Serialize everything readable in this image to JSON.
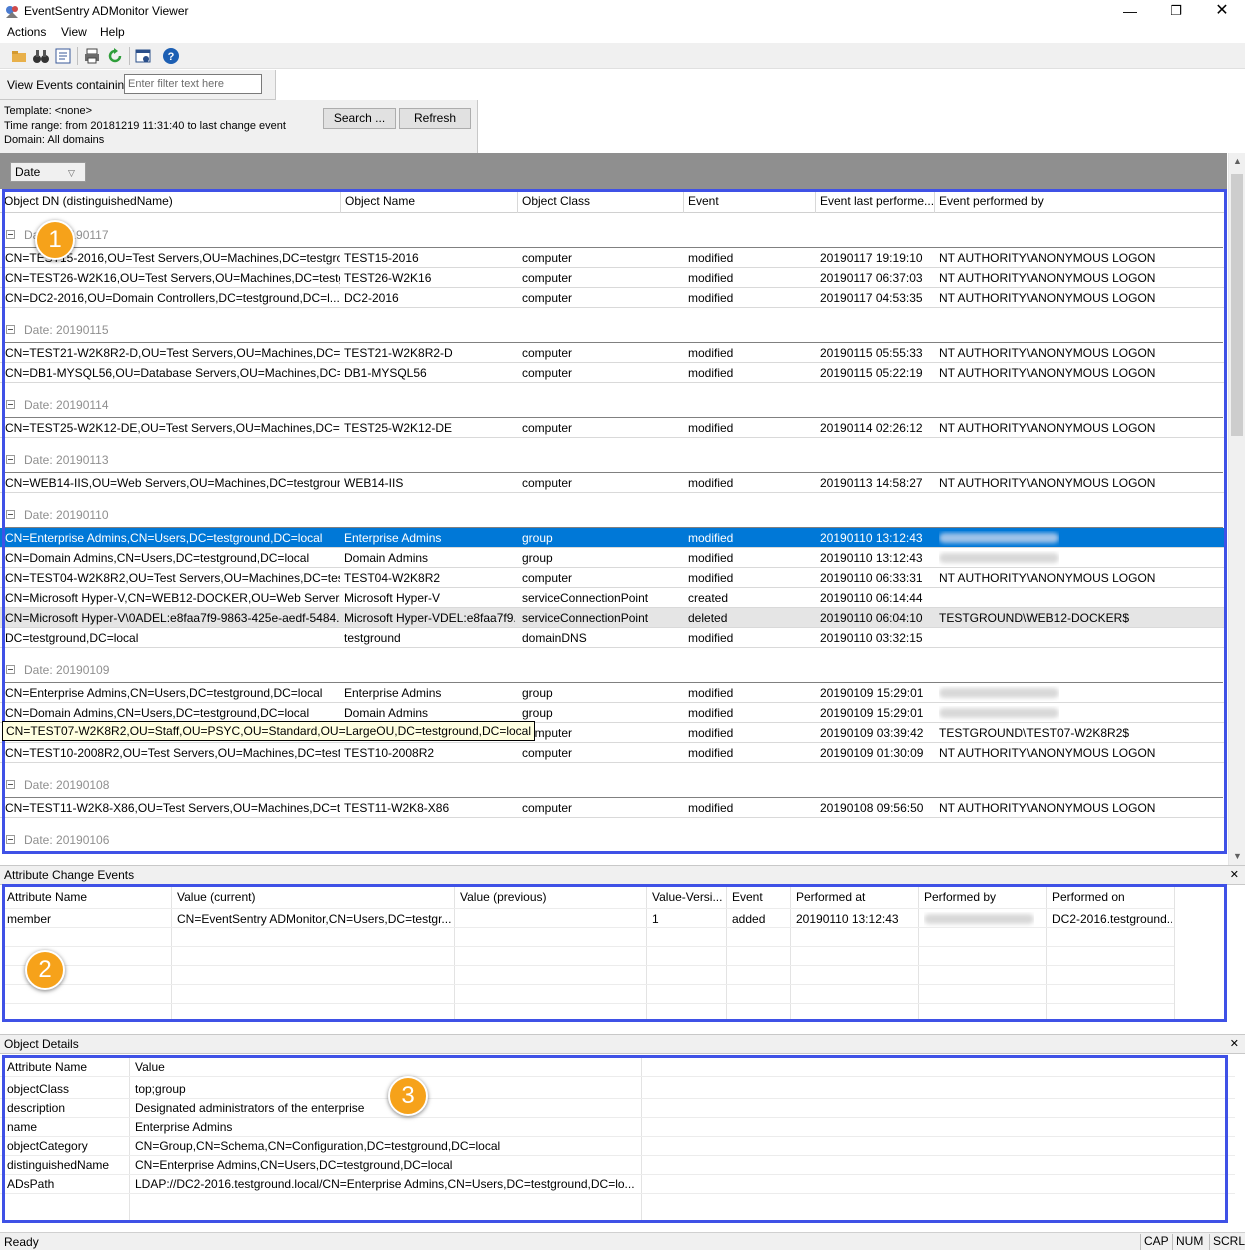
{
  "window": {
    "title": "EventSentry ADMonitor Viewer"
  },
  "menu": [
    "Actions",
    "View",
    "Help"
  ],
  "toolbar_icons": [
    "open-icon",
    "binoculars-icon",
    "report-icon",
    "print-icon",
    "refresh-icon",
    "window-icon",
    "help-icon"
  ],
  "filter": {
    "label": "View Events containing",
    "placeholder": "Enter filter text here"
  },
  "info": {
    "template": "Template: <none>",
    "time_range": "Time range: from 20181219 11:31:40 to last change event",
    "domain": "Domain: All domains"
  },
  "buttons": {
    "search": "Search ...",
    "refresh": "Refresh"
  },
  "groupby": {
    "chip": "Date"
  },
  "grid": {
    "columns": [
      "Object DN (distinguishedName)",
      "Object Name",
      "Object Class",
      "Event",
      "Event last performe...",
      "Event performed by"
    ],
    "groups": [
      {
        "label": "Date: 20190117",
        "rows": [
          {
            "dn": "CN=TEST15-2016,OU=Test Servers,OU=Machines,DC=testgro...",
            "name": "TEST15-2016",
            "cls": "computer",
            "ev": "modified",
            "t": "20190117 19:19:10",
            "by": "NT AUTHORITY\\ANONYMOUS LOGON"
          },
          {
            "dn": "CN=TEST26-W2K16,OU=Test Servers,OU=Machines,DC=testg...",
            "name": "TEST26-W2K16",
            "cls": "computer",
            "ev": "modified",
            "t": "20190117 06:37:03",
            "by": "NT AUTHORITY\\ANONYMOUS LOGON"
          },
          {
            "dn": "CN=DC2-2016,OU=Domain Controllers,DC=testground,DC=l...",
            "name": "DC2-2016",
            "cls": "computer",
            "ev": "modified",
            "t": "20190117 04:53:35",
            "by": "NT AUTHORITY\\ANONYMOUS LOGON"
          }
        ]
      },
      {
        "label": "Date: 20190115",
        "rows": [
          {
            "dn": "CN=TEST21-W2K8R2-D,OU=Test Servers,OU=Machines,DC=t...",
            "name": "TEST21-W2K8R2-D",
            "cls": "computer",
            "ev": "modified",
            "t": "20190115 05:55:33",
            "by": "NT AUTHORITY\\ANONYMOUS LOGON"
          },
          {
            "dn": "CN=DB1-MYSQL56,OU=Database Servers,OU=Machines,DC=...",
            "name": "DB1-MYSQL56",
            "cls": "computer",
            "ev": "modified",
            "t": "20190115 05:22:19",
            "by": "NT AUTHORITY\\ANONYMOUS LOGON"
          }
        ]
      },
      {
        "label": "Date: 20190114",
        "rows": [
          {
            "dn": "CN=TEST25-W2K12-DE,OU=Test Servers,OU=Machines,DC=t...",
            "name": "TEST25-W2K12-DE",
            "cls": "computer",
            "ev": "modified",
            "t": "20190114 02:26:12",
            "by": "NT AUTHORITY\\ANONYMOUS LOGON"
          }
        ]
      },
      {
        "label": "Date: 20190113",
        "rows": [
          {
            "dn": "CN=WEB14-IIS,OU=Web Servers,OU=Machines,DC=testgroun...",
            "name": "WEB14-IIS",
            "cls": "computer",
            "ev": "modified",
            "t": "20190113 14:58:27",
            "by": "NT AUTHORITY\\ANONYMOUS LOGON"
          }
        ]
      },
      {
        "label": "Date: 20190110",
        "rows": [
          {
            "dn": "CN=Enterprise Admins,CN=Users,DC=testground,DC=local",
            "name": "Enterprise Admins",
            "cls": "group",
            "ev": "modified",
            "t": "20190110 13:12:43",
            "by": "",
            "state": "sel",
            "blur": true
          },
          {
            "dn": "CN=Domain Admins,CN=Users,DC=testground,DC=local",
            "name": "Domain Admins",
            "cls": "group",
            "ev": "modified",
            "t": "20190110 13:12:43",
            "by": "",
            "blur": true
          },
          {
            "dn": "CN=TEST04-W2K8R2,OU=Test Servers,OU=Machines,DC=test...",
            "name": "TEST04-W2K8R2",
            "cls": "computer",
            "ev": "modified",
            "t": "20190110 06:33:31",
            "by": "NT AUTHORITY\\ANONYMOUS LOGON"
          },
          {
            "dn": "CN=Microsoft Hyper-V,CN=WEB12-DOCKER,OU=Web Server...",
            "name": "Microsoft Hyper-V",
            "cls": "serviceConnectionPoint",
            "ev": "created",
            "t": "20190110 06:14:44",
            "by": ""
          },
          {
            "dn": "CN=Microsoft Hyper-V\\0ADEL:e8faa7f9-9863-425e-aedf-5484...",
            "name": "Microsoft Hyper-VDEL:e8faa7f9...",
            "cls": "serviceConnectionPoint",
            "ev": "deleted",
            "t": "20190110 06:04:10",
            "by": "TESTGROUND\\WEB12-DOCKER$",
            "state": "hl"
          },
          {
            "dn": "DC=testground,DC=local",
            "name": "testground",
            "cls": "domainDNS",
            "ev": "modified",
            "t": "20190110 03:32:15",
            "by": ""
          }
        ]
      },
      {
        "label": "Date: 20190109",
        "rows": [
          {
            "dn": "CN=Enterprise Admins,CN=Users,DC=testground,DC=local",
            "name": "Enterprise Admins",
            "cls": "group",
            "ev": "modified",
            "t": "20190109 15:29:01",
            "by": "",
            "blur": true
          },
          {
            "dn": "CN=Domain Admins,CN=Users,DC=testground,DC=local",
            "name": "Domain Admins",
            "cls": "group",
            "ev": "modified",
            "t": "20190109 15:29:01",
            "by": "",
            "blur": true
          },
          {
            "dn": "CN=TEST07-W2K8R2,OU=Staff,OU=PSYC,OU=Standard,OU=LargeOU,DC=testground,DC=local",
            "name": "computer",
            "cls": "",
            "ev": "modified",
            "t": "20190109 03:39:42",
            "by": "TESTGROUND\\TEST07-W2K8R2$",
            "tooltip": true
          },
          {
            "dn": "CN=TEST10-2008R2,OU=Test Servers,OU=Machines,DC=testg...",
            "name": "TEST10-2008R2",
            "cls": "computer",
            "ev": "modified",
            "t": "20190109 01:30:09",
            "by": "NT AUTHORITY\\ANONYMOUS LOGON"
          }
        ]
      },
      {
        "label": "Date: 20190108",
        "rows": [
          {
            "dn": "CN=TEST11-W2K8-X86,OU=Test Servers,OU=Machines,DC=te...",
            "name": "TEST11-W2K8-X86",
            "cls": "computer",
            "ev": "modified",
            "t": "20190108 09:56:50",
            "by": "NT AUTHORITY\\ANONYMOUS LOGON"
          }
        ]
      },
      {
        "label": "Date: 20190106",
        "rows": []
      }
    ]
  },
  "attr_panel": {
    "title": "Attribute Change Events",
    "columns": [
      "Attribute Name",
      "Value (current)",
      "Value (previous)",
      "Value-Versi...",
      "Event",
      "Performed at",
      "Performed by",
      "Performed on"
    ],
    "row": {
      "attr": "member",
      "cur": "CN=EventSentry ADMonitor,CN=Users,DC=testgr...",
      "prev": "",
      "ver": "1",
      "ev": "added",
      "at": "20190110 13:12:43",
      "by": "",
      "on": "DC2-2016.testground..."
    }
  },
  "obj_panel": {
    "title": "Object Details",
    "columns": [
      "Attribute Name",
      "Value"
    ],
    "rows": [
      {
        "k": "objectClass",
        "v": "top;group"
      },
      {
        "k": "description",
        "v": "Designated administrators of the enterprise"
      },
      {
        "k": "name",
        "v": "Enterprise Admins"
      },
      {
        "k": "objectCategory",
        "v": "CN=Group,CN=Schema,CN=Configuration,DC=testground,DC=local"
      },
      {
        "k": "distinguishedName",
        "v": "CN=Enterprise Admins,CN=Users,DC=testground,DC=local"
      },
      {
        "k": "ADsPath",
        "v": "LDAP://DC2-2016.testground.local/CN=Enterprise Admins,CN=Users,DC=testground,DC=lo..."
      }
    ]
  },
  "callouts": [
    "1",
    "2",
    "3"
  ],
  "status": {
    "text": "Ready",
    "indicators": [
      "CAP",
      "NUM",
      "SCRL"
    ]
  },
  "colors": {
    "selection": "#0078d7",
    "annotation": "#3f51e6",
    "badge": "#f6a21a"
  }
}
